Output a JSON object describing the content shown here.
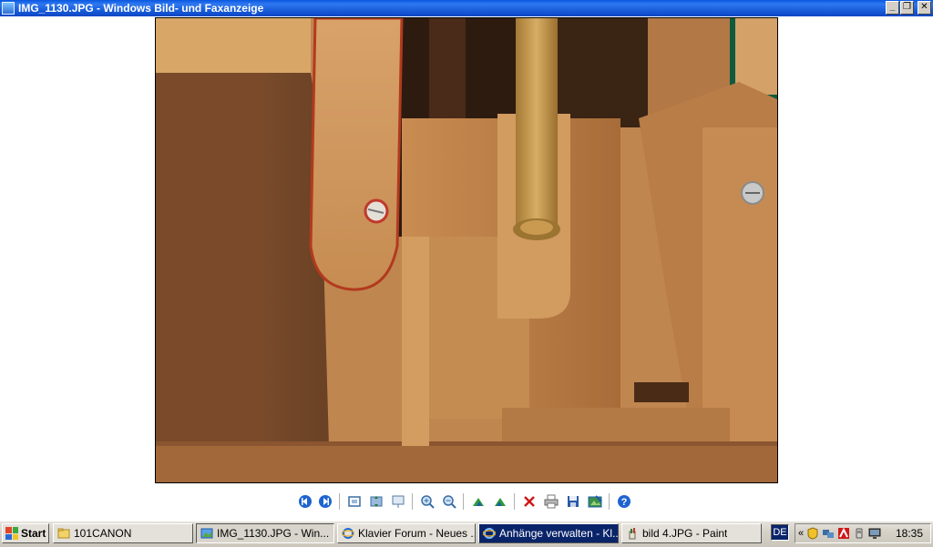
{
  "window": {
    "title": "IMG_1130.JPG - Windows Bild- und Faxanzeige"
  },
  "photo": {
    "filename": "IMG_1130.JPG"
  },
  "toolbar": {
    "buttons": [
      {
        "name": "previous-image-icon"
      },
      {
        "name": "next-image-icon"
      },
      {
        "name": "best-fit-icon"
      },
      {
        "name": "actual-size-icon"
      },
      {
        "name": "slideshow-icon"
      },
      {
        "name": "zoom-in-icon"
      },
      {
        "name": "zoom-out-icon"
      },
      {
        "name": "rotate-clockwise-icon"
      },
      {
        "name": "rotate-counterclockwise-icon"
      },
      {
        "name": "delete-icon"
      },
      {
        "name": "print-icon"
      },
      {
        "name": "save-icon"
      },
      {
        "name": "edit-icon"
      },
      {
        "name": "help-icon"
      }
    ]
  },
  "taskbar": {
    "start_label": "Start",
    "tasks": [
      {
        "label": "101CANON",
        "icon": "folder-icon"
      },
      {
        "label": "IMG_1130.JPG - Win...",
        "icon": "image-viewer-icon",
        "state": "active"
      },
      {
        "label": "Klavier Forum - Neues ...",
        "icon": "internet-explorer-icon"
      },
      {
        "label": "Anhänge verwalten - Kl...",
        "icon": "internet-explorer-icon",
        "state": "selected"
      },
      {
        "label": "bild 4.JPG - Paint",
        "icon": "paint-icon"
      }
    ],
    "language": "DE",
    "tray_chevron": "«",
    "clock": "18:35"
  },
  "colors": {
    "title_bar": "#0a58e0",
    "taskbar": "#d6d2c8",
    "selected_task": "#0a246a"
  }
}
